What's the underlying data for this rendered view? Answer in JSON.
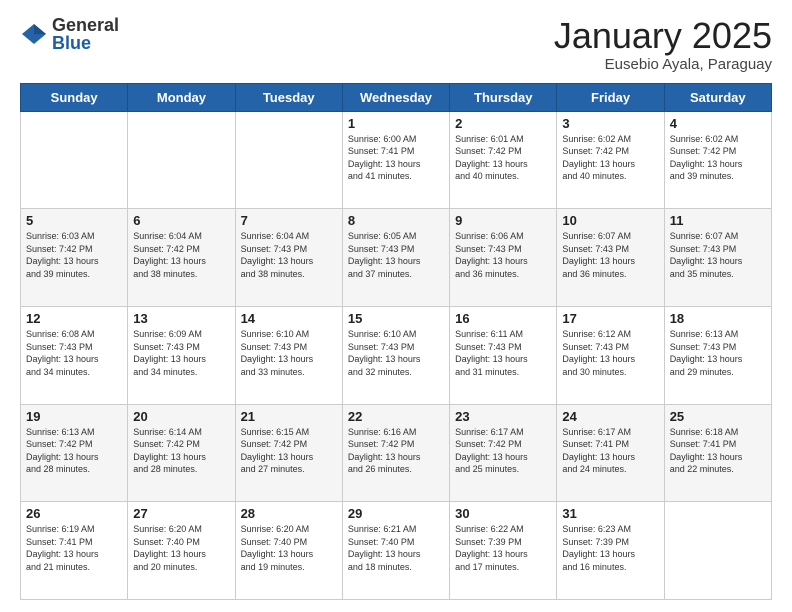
{
  "logo": {
    "general": "General",
    "blue": "Blue"
  },
  "header": {
    "title": "January 2025",
    "subtitle": "Eusebio Ayala, Paraguay"
  },
  "weekdays": [
    "Sunday",
    "Monday",
    "Tuesday",
    "Wednesday",
    "Thursday",
    "Friday",
    "Saturday"
  ],
  "weeks": [
    [
      {
        "day": "",
        "info": ""
      },
      {
        "day": "",
        "info": ""
      },
      {
        "day": "",
        "info": ""
      },
      {
        "day": "1",
        "info": "Sunrise: 6:00 AM\nSunset: 7:41 PM\nDaylight: 13 hours\nand 41 minutes."
      },
      {
        "day": "2",
        "info": "Sunrise: 6:01 AM\nSunset: 7:42 PM\nDaylight: 13 hours\nand 40 minutes."
      },
      {
        "day": "3",
        "info": "Sunrise: 6:02 AM\nSunset: 7:42 PM\nDaylight: 13 hours\nand 40 minutes."
      },
      {
        "day": "4",
        "info": "Sunrise: 6:02 AM\nSunset: 7:42 PM\nDaylight: 13 hours\nand 39 minutes."
      }
    ],
    [
      {
        "day": "5",
        "info": "Sunrise: 6:03 AM\nSunset: 7:42 PM\nDaylight: 13 hours\nand 39 minutes."
      },
      {
        "day": "6",
        "info": "Sunrise: 6:04 AM\nSunset: 7:42 PM\nDaylight: 13 hours\nand 38 minutes."
      },
      {
        "day": "7",
        "info": "Sunrise: 6:04 AM\nSunset: 7:43 PM\nDaylight: 13 hours\nand 38 minutes."
      },
      {
        "day": "8",
        "info": "Sunrise: 6:05 AM\nSunset: 7:43 PM\nDaylight: 13 hours\nand 37 minutes."
      },
      {
        "day": "9",
        "info": "Sunrise: 6:06 AM\nSunset: 7:43 PM\nDaylight: 13 hours\nand 36 minutes."
      },
      {
        "day": "10",
        "info": "Sunrise: 6:07 AM\nSunset: 7:43 PM\nDaylight: 13 hours\nand 36 minutes."
      },
      {
        "day": "11",
        "info": "Sunrise: 6:07 AM\nSunset: 7:43 PM\nDaylight: 13 hours\nand 35 minutes."
      }
    ],
    [
      {
        "day": "12",
        "info": "Sunrise: 6:08 AM\nSunset: 7:43 PM\nDaylight: 13 hours\nand 34 minutes."
      },
      {
        "day": "13",
        "info": "Sunrise: 6:09 AM\nSunset: 7:43 PM\nDaylight: 13 hours\nand 34 minutes."
      },
      {
        "day": "14",
        "info": "Sunrise: 6:10 AM\nSunset: 7:43 PM\nDaylight: 13 hours\nand 33 minutes."
      },
      {
        "day": "15",
        "info": "Sunrise: 6:10 AM\nSunset: 7:43 PM\nDaylight: 13 hours\nand 32 minutes."
      },
      {
        "day": "16",
        "info": "Sunrise: 6:11 AM\nSunset: 7:43 PM\nDaylight: 13 hours\nand 31 minutes."
      },
      {
        "day": "17",
        "info": "Sunrise: 6:12 AM\nSunset: 7:43 PM\nDaylight: 13 hours\nand 30 minutes."
      },
      {
        "day": "18",
        "info": "Sunrise: 6:13 AM\nSunset: 7:43 PM\nDaylight: 13 hours\nand 29 minutes."
      }
    ],
    [
      {
        "day": "19",
        "info": "Sunrise: 6:13 AM\nSunset: 7:42 PM\nDaylight: 13 hours\nand 28 minutes."
      },
      {
        "day": "20",
        "info": "Sunrise: 6:14 AM\nSunset: 7:42 PM\nDaylight: 13 hours\nand 28 minutes."
      },
      {
        "day": "21",
        "info": "Sunrise: 6:15 AM\nSunset: 7:42 PM\nDaylight: 13 hours\nand 27 minutes."
      },
      {
        "day": "22",
        "info": "Sunrise: 6:16 AM\nSunset: 7:42 PM\nDaylight: 13 hours\nand 26 minutes."
      },
      {
        "day": "23",
        "info": "Sunrise: 6:17 AM\nSunset: 7:42 PM\nDaylight: 13 hours\nand 25 minutes."
      },
      {
        "day": "24",
        "info": "Sunrise: 6:17 AM\nSunset: 7:41 PM\nDaylight: 13 hours\nand 24 minutes."
      },
      {
        "day": "25",
        "info": "Sunrise: 6:18 AM\nSunset: 7:41 PM\nDaylight: 13 hours\nand 22 minutes."
      }
    ],
    [
      {
        "day": "26",
        "info": "Sunrise: 6:19 AM\nSunset: 7:41 PM\nDaylight: 13 hours\nand 21 minutes."
      },
      {
        "day": "27",
        "info": "Sunrise: 6:20 AM\nSunset: 7:40 PM\nDaylight: 13 hours\nand 20 minutes."
      },
      {
        "day": "28",
        "info": "Sunrise: 6:20 AM\nSunset: 7:40 PM\nDaylight: 13 hours\nand 19 minutes."
      },
      {
        "day": "29",
        "info": "Sunrise: 6:21 AM\nSunset: 7:40 PM\nDaylight: 13 hours\nand 18 minutes."
      },
      {
        "day": "30",
        "info": "Sunrise: 6:22 AM\nSunset: 7:39 PM\nDaylight: 13 hours\nand 17 minutes."
      },
      {
        "day": "31",
        "info": "Sunrise: 6:23 AM\nSunset: 7:39 PM\nDaylight: 13 hours\nand 16 minutes."
      },
      {
        "day": "",
        "info": ""
      }
    ]
  ]
}
